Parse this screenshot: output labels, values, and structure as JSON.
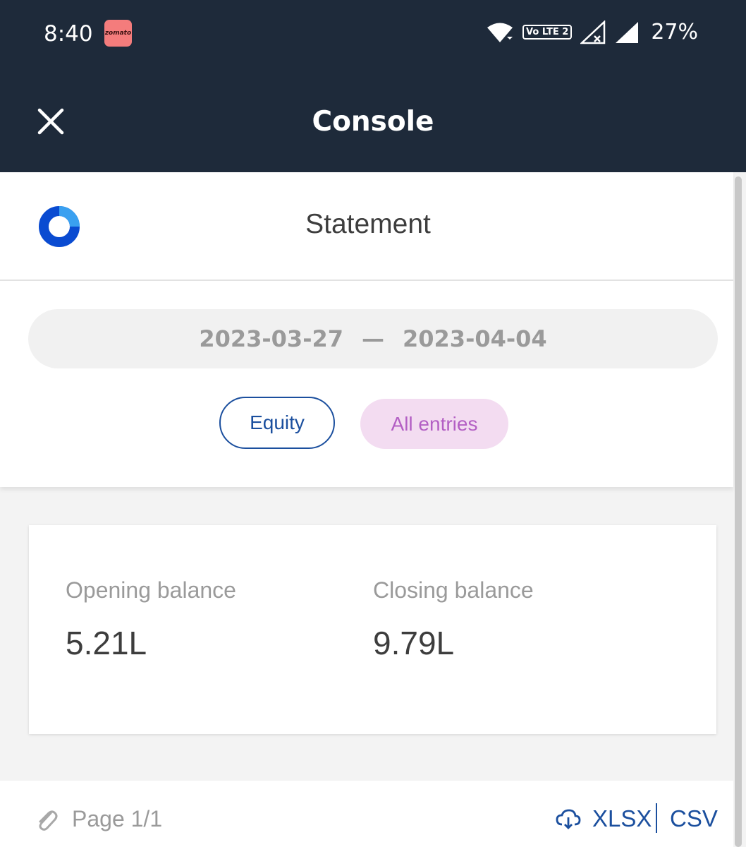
{
  "status_bar": {
    "time": "8:40",
    "notification_app": "zomato",
    "network_badge": "Vo LTE 2",
    "battery": "27%",
    "icons": [
      "wifi-icon",
      "volte-icon",
      "signal-no-service-icon",
      "signal-icon"
    ]
  },
  "header": {
    "title": "Console",
    "close_icon": "close-icon"
  },
  "statement": {
    "title": "Statement",
    "logo_icon": "console-logo-icon",
    "date_from": "2023-03-27",
    "date_separator": "—",
    "date_to": "2023-04-04",
    "segment_chip": "Equity",
    "entries_chip": "All entries"
  },
  "balances": {
    "opening_label": "Opening balance",
    "opening_value": "5.21L",
    "closing_label": "Closing balance",
    "closing_value": "9.79L"
  },
  "footer": {
    "page_text": "Page 1/1",
    "xlsx_label": "XLSX",
    "csv_label": "CSV",
    "attachment_icon": "paperclip-icon",
    "download_icon": "cloud-download-icon"
  },
  "colors": {
    "header_bg": "#1e2a3a",
    "accent_blue": "#1b4f9e",
    "chip_pink_bg": "#f3dcf1",
    "chip_pink_text": "#b35fc4"
  }
}
